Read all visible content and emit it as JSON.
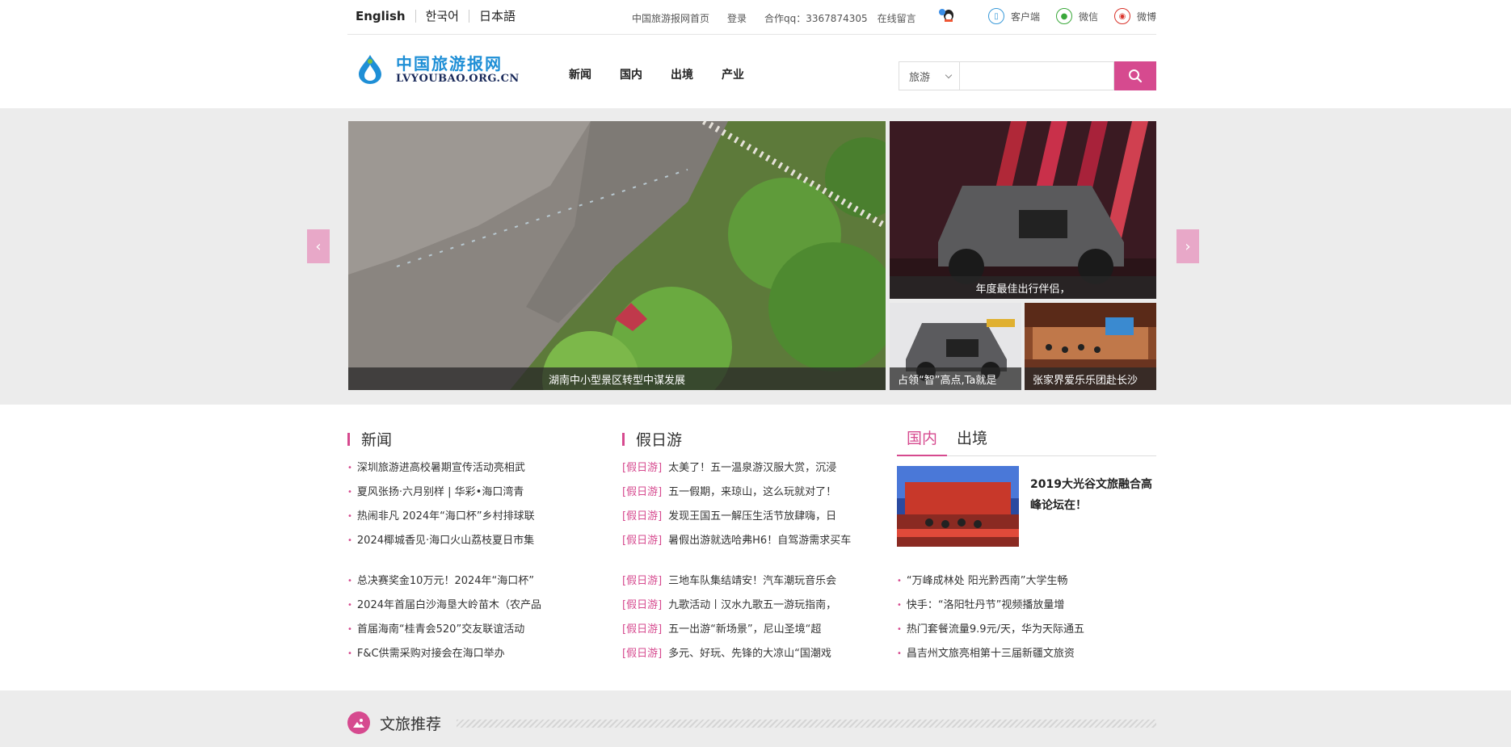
{
  "topbar": {
    "languages": [
      "English",
      "한국어",
      "日本語"
    ],
    "links": {
      "home": "中国旅游报网首页",
      "login": "登录",
      "qq": "合作qq：3367874305",
      "online_msg": "在线留言"
    },
    "social": {
      "client": "客户端",
      "wechat": "微信",
      "weibo": "微博"
    }
  },
  "header": {
    "logo_cn": "中国旅游报网",
    "logo_en": "LVYOUBAO.ORG.CN",
    "nav": [
      "新闻",
      "国内",
      "出境",
      "产业"
    ],
    "search": {
      "category": "旅游",
      "placeholder": ""
    }
  },
  "banner": {
    "main_caption": "湖南中小型景区转型中谋发展",
    "side_top_caption": "年度最佳出行伴侣，",
    "side_bl_caption": "占领“智”高点,Ta就是",
    "side_br_caption": "张家界爱乐乐团赴长沙"
  },
  "news": {
    "title": "新闻",
    "group1": [
      "深圳旅游进高校暑期宣传活动亮相武",
      "夏风张扬·六月别样 | 华彩•海口湾青",
      "热闹非凡 2024年“海口杯”乡村排球联",
      "2024椰城香见·海口火山荔枝夏日市集"
    ],
    "group2": [
      "总决赛奖金10万元！2024年“海口杯”",
      "2024年首届白沙海垦大岭苗木（农产品",
      "首届海南“桂青会520”交友联谊活动",
      "F&C供需采购对接会在海口举办"
    ]
  },
  "holiday": {
    "title": "假日游",
    "tag": "[假日游]",
    "group1": [
      "太美了！五一温泉游汉服大赏，沉浸",
      "五一假期，来琼山，这么玩就对了！",
      "发现王国五一解压生活节放肆嗨，日",
      "暑假出游就选哈弗H6！自驾游需求买车"
    ],
    "group2": [
      "三地车队集结靖安！汽车潮玩音乐会",
      "九歌活动丨汉水九歌五一游玩指南，",
      "五一出游“新场景”，尼山圣境“超",
      "多元、好玩、先锋的大凉山“国潮戏"
    ]
  },
  "domestic": {
    "tabs": [
      "国内",
      "出境"
    ],
    "feature_title": "2019大光谷文旅融合高峰论坛在！",
    "list": [
      "“万峰成林处 阳光黔西南”大学生畅",
      "快手：“洛阳牡丹节”视频播放量增",
      "热门套餐流量9.9元/天，华为天际通五",
      "昌吉州文旅亮相第十三届新疆文旅资"
    ]
  },
  "recommend": {
    "title": "文旅推荐"
  },
  "colors": {
    "accent": "#d64a8f",
    "logo_blue": "#1f8fd6"
  }
}
